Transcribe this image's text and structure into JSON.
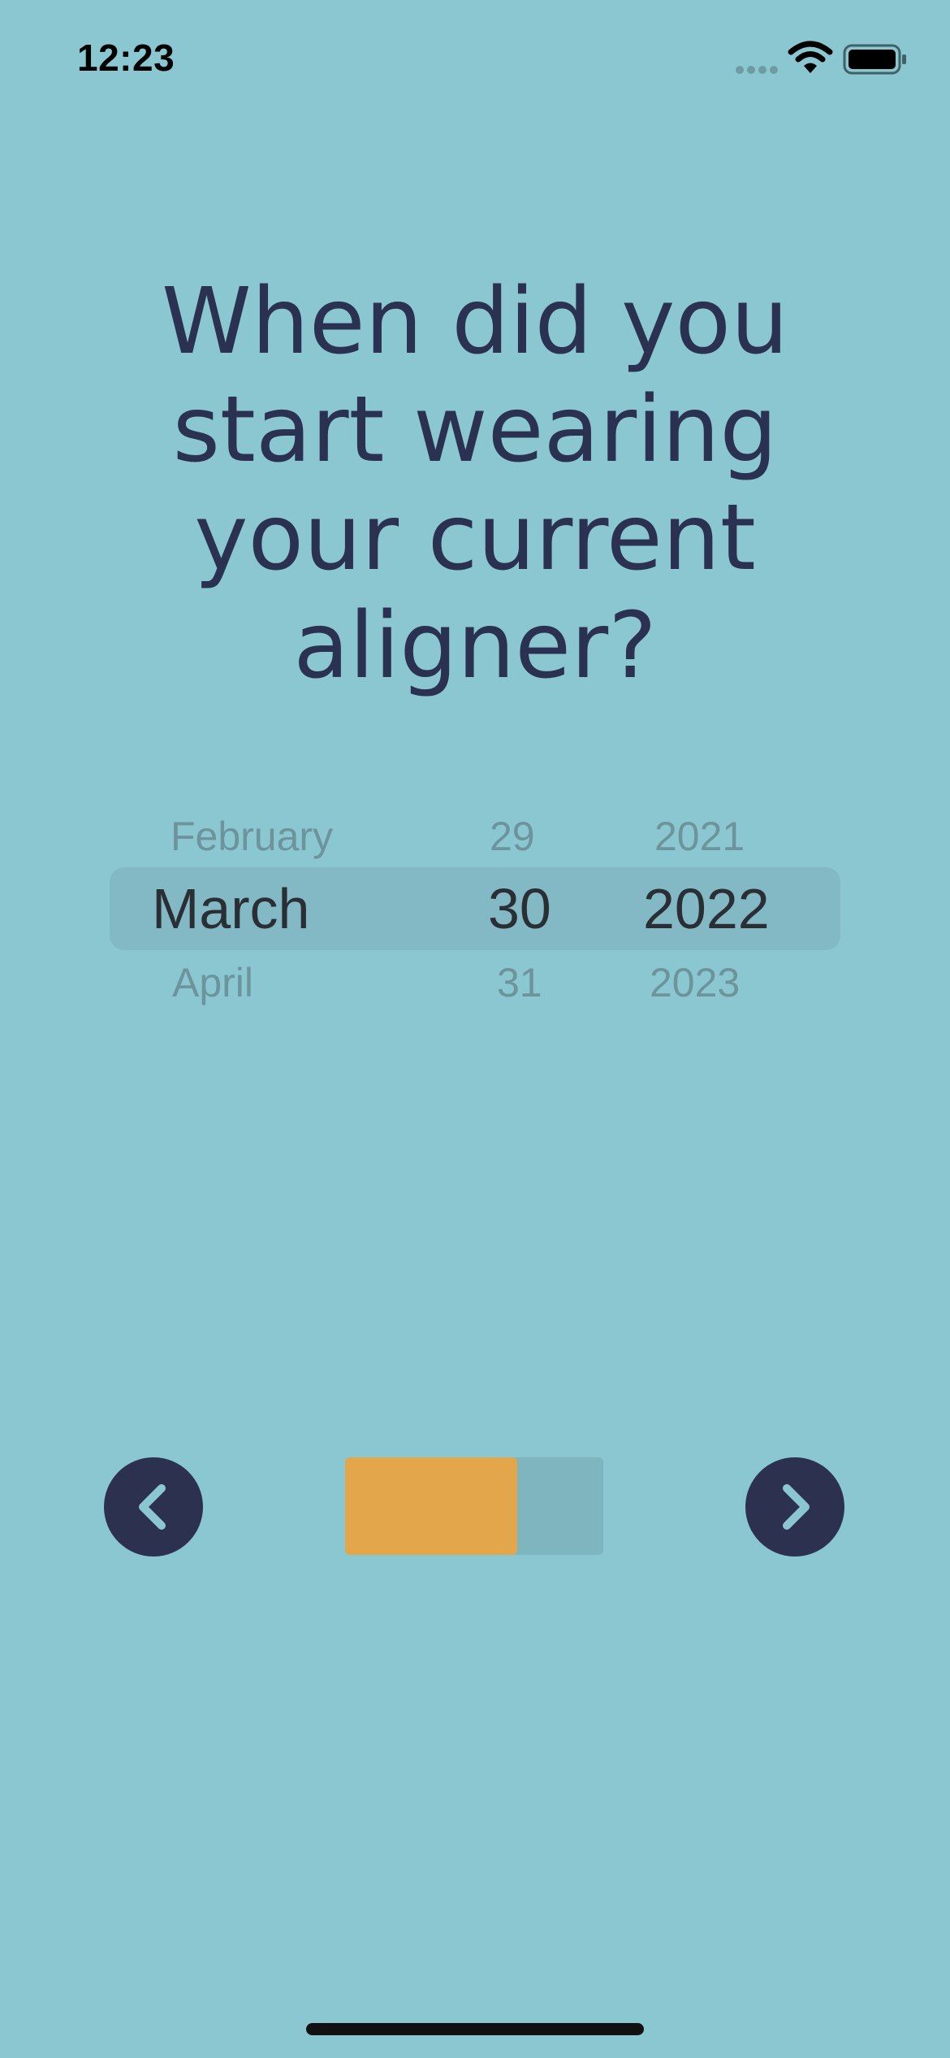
{
  "status_bar": {
    "time": "12:23",
    "icons": [
      "cellular-signal-icon",
      "wifi-icon",
      "battery-icon"
    ]
  },
  "question": {
    "lines": [
      "When did you",
      "start wearing",
      "your current",
      "aligner?"
    ]
  },
  "date_picker": {
    "month": {
      "previous": "February",
      "selected": "March",
      "next": "April"
    },
    "day": {
      "previous": "29",
      "selected": "30",
      "next": "31"
    },
    "year": {
      "previous": "2021",
      "selected": "2022",
      "next": "2023"
    }
  },
  "navigation": {
    "back_icon": "chevron-left-icon",
    "next_icon": "chevron-right-icon",
    "progress_fraction": 0.6667
  },
  "colors": {
    "background": "#8bc7d1",
    "text_dark": "#2b3150",
    "button": "#2c3150",
    "accent": "#e4a64b"
  }
}
